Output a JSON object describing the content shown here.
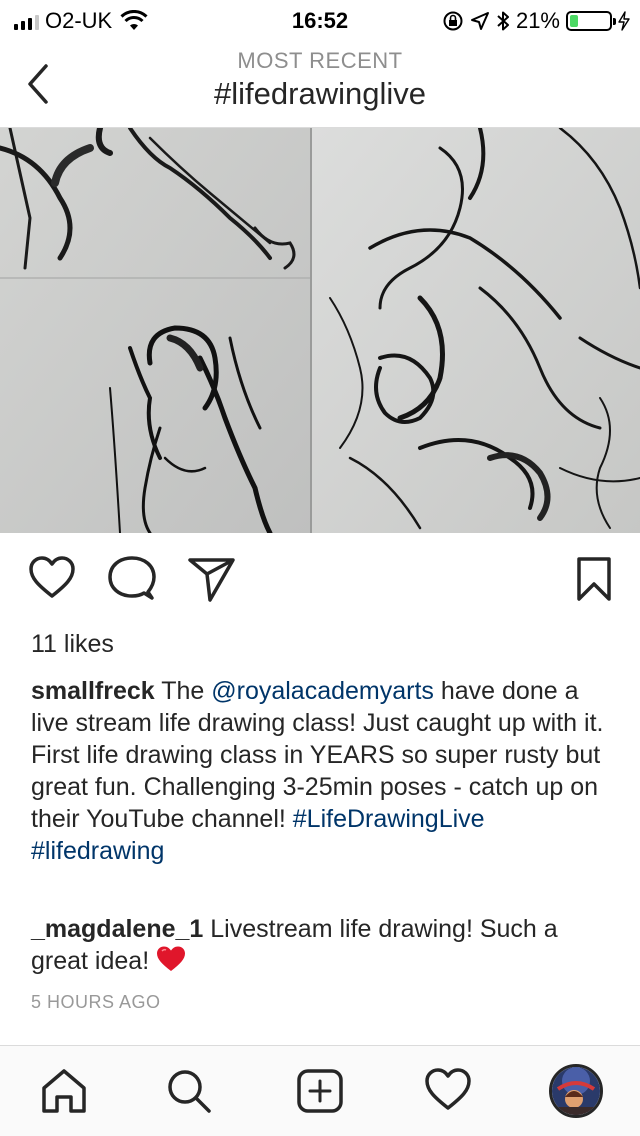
{
  "status_bar": {
    "carrier": "O2-UK",
    "time": "16:52",
    "battery_percent": "21%",
    "battery_level": 0.21,
    "battery_color": "#4cd964"
  },
  "header": {
    "subtitle": "MOST RECENT",
    "title": "#lifedrawinglive",
    "back_icon": "chevron-left-icon"
  },
  "post": {
    "image_alt": "charcoal life drawing sketches",
    "likes": "11 likes",
    "caption": {
      "username": "smallfreck",
      "text_1": " The ",
      "mention": "@royalacademyarts",
      "text_2": " have done a live stream life drawing class! Just caught up with it. First life drawing class in YEARS so super rusty but great fun. Challenging 3-25min poses - catch up on their YouTube channel! ",
      "hashtag_1": "#LifeDrawingLive",
      "hashtag_2": "#lifedrawing"
    },
    "comment": {
      "username": "_magdalene_1",
      "text": " Livestream life drawing! Such a great idea! "
    },
    "timestamp": "5 HOURS AGO",
    "link_color": "#003569"
  },
  "tab_bar": {
    "items": [
      "home-icon",
      "search-icon",
      "add-post-icon",
      "activity-heart-icon",
      "profile-avatar"
    ]
  }
}
